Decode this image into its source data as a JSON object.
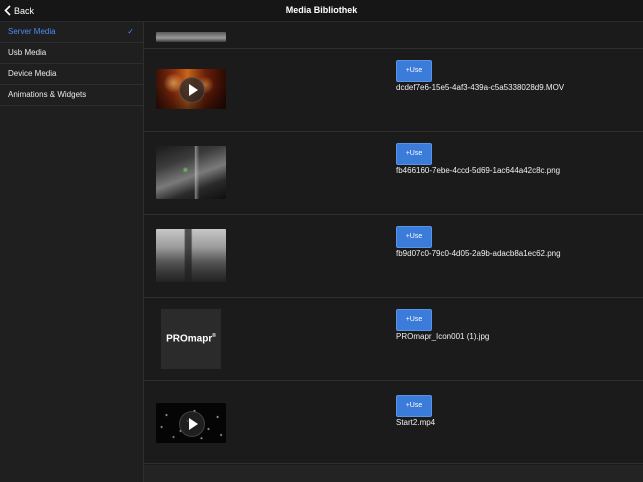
{
  "nav": {
    "back_label": "Back",
    "title": "Media Bibliothek"
  },
  "sidebar": {
    "items": [
      {
        "label": "Server Media",
        "selected": true
      },
      {
        "label": "Usb Media",
        "selected": false
      },
      {
        "label": "Device Media",
        "selected": false
      },
      {
        "label": "Animations & Widgets",
        "selected": false
      }
    ],
    "check_icon": "✓"
  },
  "media": {
    "use_label": "+Use",
    "items": [
      {
        "filename": "dcdef7e6-15e5-4af3-439a-c5a5338028d9.MOV",
        "thumb": "video-thumbnail",
        "is_video": true
      },
      {
        "filename": "fb466160-7ebe-4ccd-5d69-1ac644a42c8c.png",
        "thumb": "image-thumbnail",
        "is_video": false
      },
      {
        "filename": "fb9d07c0-79c0-4d05-2a9b-adacb8a1ec62.png",
        "thumb": "image-thumbnail",
        "is_video": false
      },
      {
        "filename": "PROmapr_Icon001 (1).jpg",
        "thumb": "logo-thumbnail",
        "is_video": false,
        "logo_text": "PROmapr",
        "logo_mark": "®"
      },
      {
        "filename": "Start2.mp4",
        "thumb": "video-thumbnail",
        "is_video": true
      }
    ]
  },
  "colors": {
    "accent": "#4b8bf5",
    "button": "#3b7bd9",
    "background": "#1b1b1b"
  }
}
